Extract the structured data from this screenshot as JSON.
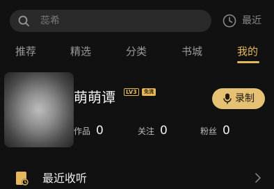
{
  "search": {
    "placeholder": "蕊希",
    "recent_label": "最近"
  },
  "tabs": [
    {
      "label": "推荐"
    },
    {
      "label": "精选"
    },
    {
      "label": "分类"
    },
    {
      "label": "书城"
    },
    {
      "label": "我的"
    }
  ],
  "profile": {
    "username": "萌萌谭",
    "level_badge": "LV3",
    "free_badge": "免流",
    "record_label": "录制",
    "stats": [
      {
        "label": "作品",
        "value": "0"
      },
      {
        "label": "关注",
        "value": "0"
      },
      {
        "label": "粉丝",
        "value": "0"
      }
    ]
  },
  "menu": {
    "recent_listen": "最近收听"
  },
  "colors": {
    "accent": "#e6b85c",
    "record_button": "#e6c073",
    "background": "#111111"
  },
  "icons": {
    "search": "search-icon",
    "recent": "clock-icon",
    "record": "microphone-icon",
    "recent_listen": "history-book-icon",
    "chevron": "chevron-right-icon"
  }
}
